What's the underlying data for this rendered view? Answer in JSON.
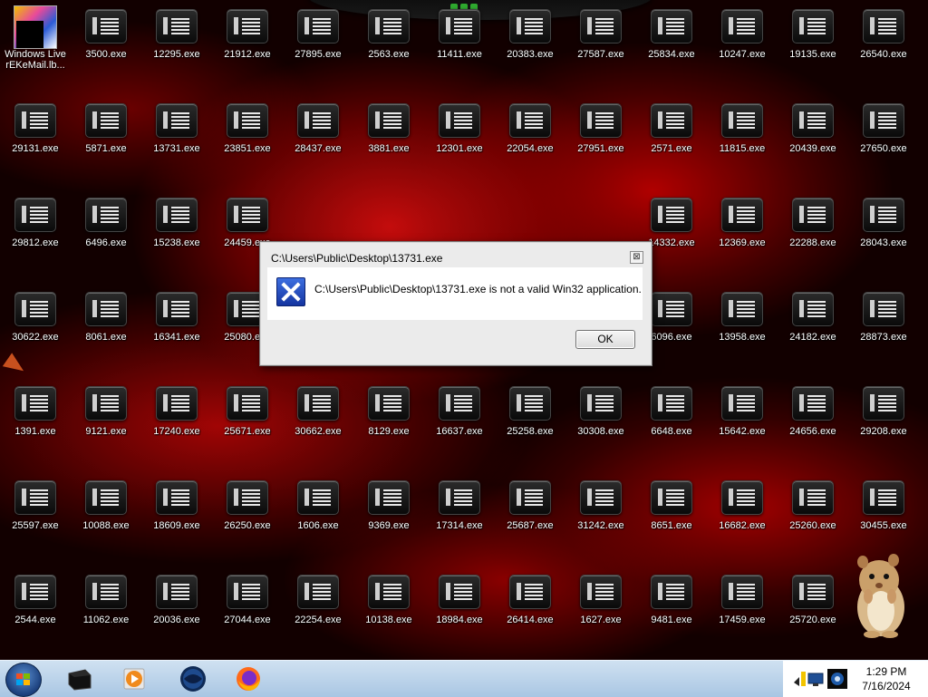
{
  "desktop": {
    "windows_live": {
      "line1": "Windows Live",
      "line2": "rEKeMail.lb..."
    },
    "icons": [
      "3500.exe",
      "12295.exe",
      "21912.exe",
      "27895.exe",
      "2563.exe",
      "11411.exe",
      "20383.exe",
      "27587.exe",
      "25834.exe",
      "10247.exe",
      "19135.exe",
      "26540.exe",
      "29131.exe",
      "5871.exe",
      "13731.exe",
      "23851.exe",
      "28437.exe",
      "3881.exe",
      "12301.exe",
      "22054.exe",
      "27951.exe",
      "2571.exe",
      "11815.exe",
      "20439.exe",
      "27650.exe",
      "29812.exe",
      "6496.exe",
      "15238.exe",
      "24459.exe",
      "",
      "",
      "",
      "",
      "",
      "14332.exe",
      "12369.exe",
      "22288.exe",
      "28043.exe",
      "30622.exe",
      "8061.exe",
      "16341.exe",
      "25080.exe",
      "",
      "",
      "",
      "",
      "",
      "6096.exe",
      "13958.exe",
      "24182.exe",
      "28873.exe",
      "1391.exe",
      "9121.exe",
      "17240.exe",
      "25671.exe",
      "30662.exe",
      "8129.exe",
      "16637.exe",
      "25258.exe",
      "30308.exe",
      "6648.exe",
      "15642.exe",
      "24656.exe",
      "29208.exe",
      "25597.exe",
      "10088.exe",
      "18609.exe",
      "26250.exe",
      "1606.exe",
      "9369.exe",
      "17314.exe",
      "25687.exe",
      "31242.exe",
      "8651.exe",
      "16682.exe",
      "25260.exe",
      "30455.exe",
      "2544.exe",
      "11062.exe",
      "20036.exe",
      "27044.exe",
      "22254.exe",
      "10138.exe",
      "18984.exe",
      "26414.exe",
      "1627.exe",
      "9481.exe",
      "17459.exe",
      "25720.exe",
      ""
    ]
  },
  "dialog": {
    "title": "C:\\Users\\Public\\Desktop\\13731.exe",
    "message": "C:\\Users\\Public\\Desktop\\13731.exe is not a valid Win32 application.",
    "ok_label": "OK",
    "close_glyph": "⊠"
  },
  "taskbar": {
    "time": "1:29 PM",
    "date": "7/16/2024"
  }
}
